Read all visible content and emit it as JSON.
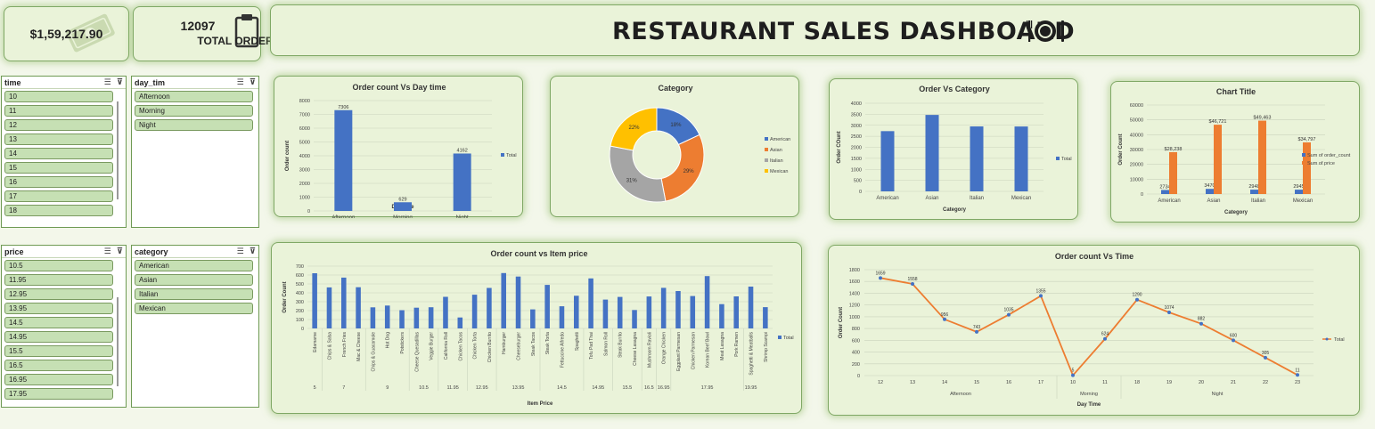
{
  "kpis": {
    "revenue": "$1,59,217.90",
    "orders_value": "12097",
    "orders_label": "TOTAL ORDER"
  },
  "header": {
    "title": "RESTAURANT SALES DASHBOARD"
  },
  "icons": {
    "money": "money-icon",
    "clipboard": "clipboard-icon",
    "plate": "plate-cutlery-icon"
  },
  "slicers": {
    "time": {
      "title": "time",
      "items": [
        "10",
        "11",
        "12",
        "13",
        "14",
        "15",
        "16",
        "17",
        "18"
      ]
    },
    "day_tim": {
      "title": "day_tim",
      "items": [
        "Afternoon",
        "Morning",
        "Night"
      ]
    },
    "price": {
      "title": "price",
      "items": [
        "10.5",
        "11.95",
        "12.95",
        "13.95",
        "14.5",
        "14.95",
        "15.5",
        "16.5",
        "16.95",
        "17.95"
      ]
    },
    "category": {
      "title": "category",
      "items": [
        "American",
        "Asian",
        "Italian",
        "Mexican"
      ]
    }
  },
  "colors": {
    "blue": "#4472c4",
    "orange": "#ed7d31",
    "gray": "#a5a5a5",
    "yellow": "#ffc000",
    "card_bg": "#eaf3d9"
  },
  "chart_data": [
    {
      "id": "daytime",
      "type": "bar",
      "title": "Order count Vs Day time",
      "xlabel": "Day time",
      "ylabel": "Order count",
      "ylim": [
        0,
        8000
      ],
      "yticks": [
        "0",
        "1000",
        "2000",
        "3000",
        "4000",
        "5000",
        "6000",
        "7000",
        "8000"
      ],
      "categories": [
        "Afternoon",
        "Morning",
        "Night"
      ],
      "series": [
        {
          "name": "Total",
          "values": [
            7306,
            629,
            4162
          ]
        }
      ],
      "labels": [
        "7306",
        "629",
        "4162"
      ],
      "legend": "right"
    },
    {
      "id": "category",
      "type": "pie",
      "title": "Category",
      "categories": [
        "American",
        "Asian",
        "Italian",
        "Mexican"
      ],
      "values": [
        18,
        29,
        31,
        22
      ],
      "labels": [
        "18%",
        "29%",
        "31%",
        "22%"
      ],
      "legend": "right"
    },
    {
      "id": "ordercat",
      "type": "bar",
      "title": "Order Vs Category",
      "xlabel": "Category",
      "ylabel": "Order COunt",
      "ylim": [
        0,
        4000
      ],
      "yticks": [
        "0",
        "500",
        "1000",
        "1500",
        "2000",
        "2500",
        "3000",
        "3500",
        "4000"
      ],
      "categories": [
        "American",
        "Asian",
        "Italian",
        "Mexican"
      ],
      "series": [
        {
          "name": "Total",
          "values": [
            2734,
            3470,
            2948,
            2945
          ]
        }
      ],
      "legend": "right"
    },
    {
      "id": "chart4",
      "type": "bar",
      "title": "Chart Title",
      "xlabel": "Category",
      "ylabel": "Order Count",
      "ylim": [
        0,
        60000
      ],
      "yticks": [
        "0",
        "10000",
        "20000",
        "30000",
        "40000",
        "50000",
        "60000"
      ],
      "categories": [
        "American",
        "Asian",
        "Italian",
        "Mexican"
      ],
      "series": [
        {
          "name": "Sum of order_count",
          "values": [
            2734,
            3470,
            2948,
            2945
          ],
          "labels": [
            "2734",
            "3470",
            "2948",
            "2945"
          ]
        },
        {
          "name": "Sum of price",
          "values": [
            28238,
            46721,
            49463,
            34797
          ],
          "labels": [
            "$28,238",
            "$46,721",
            "$49,463",
            "$34,797"
          ]
        }
      ],
      "legend": "right"
    },
    {
      "id": "itemprice",
      "type": "bar",
      "title": "Order count vs Item price",
      "xlabel": "Item Price",
      "ylabel": "Order Count",
      "ylim": [
        0,
        700
      ],
      "yticks": [
        "0",
        "100",
        "200",
        "300",
        "400",
        "500",
        "600",
        "700"
      ],
      "categories": [
        "Edamame",
        "Chips & Salsa",
        "French Fries",
        "Mac & Cheese",
        "Chips & Guacamole",
        "Hot Dog",
        "Potstickers",
        "Cheese Quesadillas",
        "Veggie Burger",
        "California Roll",
        "Chicken Tacos",
        "Chicken Torta",
        "Chicken Burrito",
        "Hamburger",
        "Cheeseburger",
        "Steak Tacos",
        "Steak Torta",
        "Fettuccine Alfredo",
        "Spaghetti",
        "Tofu Pad Thai",
        "Salmon Roll",
        "Steak Burrito",
        "Cheese Lasagna",
        "Mushroom Ravioli",
        "Orange Chicken",
        "Eggplant Parmesan",
        "Chicken Parmesan",
        "Korean Beef Bowl",
        "Meat Lasagna",
        "Pork Ramen",
        "Spaghetti & Meatballs",
        "Shrimp Scampi"
      ],
      "series": [
        {
          "name": "Total",
          "values": [
            620,
            461,
            571,
            463,
            237,
            257,
            205,
            233,
            238,
            355,
            123,
            379,
            455,
            622,
            583,
            214,
            489,
            249,
            367,
            562,
            324,
            354,
            207,
            359,
            456,
            420,
            364,
            588,
            273,
            360,
            470,
            239
          ]
        }
      ],
      "price_groups": [
        {
          "label": "5",
          "count": 1
        },
        {
          "label": "7",
          "count": 3
        },
        {
          "label": "9",
          "count": 3
        },
        {
          "label": "10.5",
          "count": 2
        },
        {
          "label": "11.95",
          "count": 2
        },
        {
          "label": "12.95",
          "count": 2
        },
        {
          "label": "13.95",
          "count": 3
        },
        {
          "label": "14.5",
          "count": 3
        },
        {
          "label": "14.95",
          "count": 2
        },
        {
          "label": "15.5",
          "count": 2
        },
        {
          "label": "16.5",
          "count": 1
        },
        {
          "label": "16.95",
          "count": 1
        },
        {
          "label": "17.95",
          "count": 5
        },
        {
          "label": "19.95",
          "count": 1
        }
      ],
      "legend": "right"
    },
    {
      "id": "ordertime",
      "type": "line",
      "title": "Order count Vs Time",
      "xlabel": "Day Time",
      "ylabel": "Order Count",
      "ylim": [
        0,
        1800
      ],
      "yticks": [
        "0",
        "200",
        "400",
        "600",
        "800",
        "1000",
        "1200",
        "1400",
        "1600",
        "1800"
      ],
      "categories": [
        "12",
        "13",
        "14",
        "15",
        "16",
        "17",
        "10",
        "11",
        "18",
        "19",
        "20",
        "21",
        "22",
        "23"
      ],
      "groups": [
        {
          "label": "Afternoon",
          "count": 6
        },
        {
          "label": "Morning",
          "count": 2
        },
        {
          "label": "Night",
          "count": 6
        }
      ],
      "series": [
        {
          "name": "Total",
          "values": [
            1659,
            1558,
            956,
            743,
            1035,
            1355,
            5,
            624,
            1290,
            1074,
            882,
            600,
            305,
            11
          ]
        }
      ],
      "legend": "right"
    }
  ]
}
